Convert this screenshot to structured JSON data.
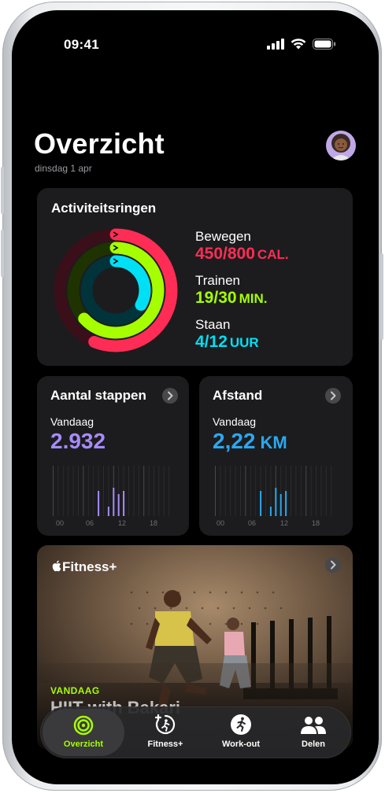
{
  "status_bar": {
    "time": "09:41"
  },
  "header": {
    "title": "Overzicht",
    "date": "dinsdag 1 apr"
  },
  "activity": {
    "title": "Activiteitsringen",
    "move": {
      "label": "Bewegen",
      "value": "450/800",
      "unit": "CAL.",
      "progress": 0.5625,
      "color": "#ff2d55"
    },
    "exercise": {
      "label": "Trainen",
      "value": "19/30",
      "unit": "MIN.",
      "progress": 0.633,
      "color": "#a6ff00"
    },
    "stand": {
      "label": "Staan",
      "value": "4/12",
      "unit": "UUR",
      "progress": 0.333,
      "color": "#00e0f5"
    }
  },
  "steps": {
    "title": "Aantal stappen",
    "period": "Vandaag",
    "value": "2.932",
    "axis": [
      "00",
      "06",
      "12",
      "18"
    ],
    "color": "#a78bfa"
  },
  "distance": {
    "title": "Afstand",
    "period": "Vandaag",
    "value": "2,22",
    "unit": "KM",
    "axis": [
      "00",
      "06",
      "12",
      "18"
    ],
    "color": "#2aa8f0"
  },
  "fitness_plus": {
    "brand": "Fitness+",
    "badge": "VANDAAG",
    "workout_title": "HIIT with Bakari"
  },
  "tabbar": {
    "items": [
      {
        "label": "Overzicht",
        "icon": "activity-rings-icon",
        "active": true
      },
      {
        "label": "Fitness+",
        "icon": "fitness-plus-icon",
        "active": false
      },
      {
        "label": "Work-out",
        "icon": "running-figure-icon",
        "active": false
      },
      {
        "label": "Delen",
        "icon": "people-icon",
        "active": false
      }
    ]
  },
  "colors": {
    "accent_green": "#a6ff00",
    "background": "#000000",
    "card": "#1c1c1e"
  }
}
